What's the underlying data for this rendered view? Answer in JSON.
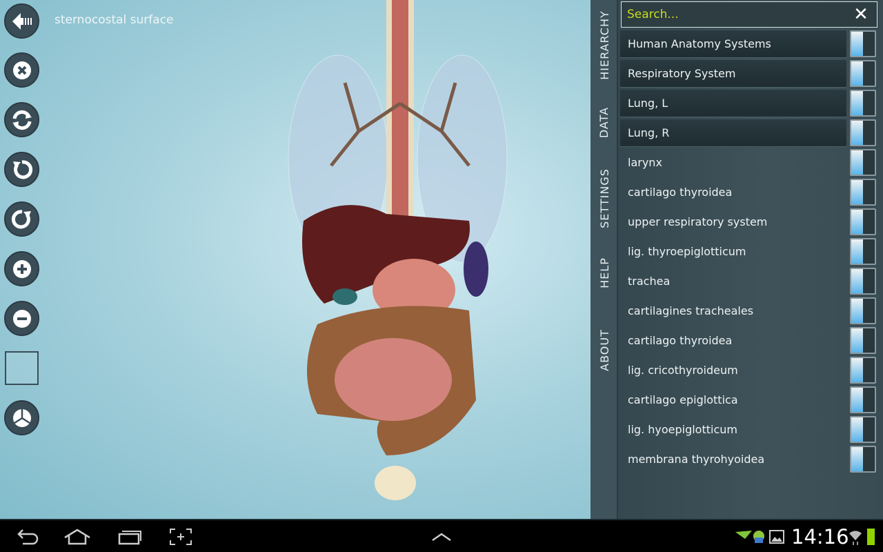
{
  "viewer": {
    "caption": "sternocostal surface",
    "tools": [
      "back",
      "hide",
      "reset-view",
      "rotate-left",
      "rotate-right",
      "zoom-in",
      "zoom-out",
      "select-box",
      "transparency"
    ]
  },
  "panel": {
    "tabs": [
      "HIERARCHY",
      "DATA",
      "SETTINGS",
      "HELP",
      "ABOUT"
    ],
    "search": {
      "placeholder": "Search...",
      "value": ""
    },
    "items": [
      {
        "label": "Human Anatomy Systems",
        "highlighted": true,
        "visible": true
      },
      {
        "label": "Respiratory System",
        "highlighted": true,
        "visible": true
      },
      {
        "label": "Lung, L",
        "highlighted": true,
        "visible": true
      },
      {
        "label": "Lung, R",
        "highlighted": true,
        "visible": true
      },
      {
        "label": "larynx",
        "highlighted": false,
        "visible": true
      },
      {
        "label": "cartilago thyroidea",
        "highlighted": false,
        "visible": true
      },
      {
        "label": "upper respiratory system",
        "highlighted": false,
        "visible": true
      },
      {
        "label": "lig. thyroepiglotticum",
        "highlighted": false,
        "visible": true
      },
      {
        "label": "trachea",
        "highlighted": false,
        "visible": true
      },
      {
        "label": "cartilagines tracheales",
        "highlighted": false,
        "visible": true
      },
      {
        "label": "cartilago thyroidea",
        "highlighted": false,
        "visible": true
      },
      {
        "label": "lig. cricothyroideum",
        "highlighted": false,
        "visible": true
      },
      {
        "label": "cartilago epiglottica",
        "highlighted": false,
        "visible": true
      },
      {
        "label": "lig. hyoepiglotticum",
        "highlighted": false,
        "visible": true
      },
      {
        "label": "membrana thyrohyoidea",
        "highlighted": false,
        "visible": true
      }
    ]
  },
  "status": {
    "time": "14:16",
    "battery_color": "#8fd400"
  }
}
